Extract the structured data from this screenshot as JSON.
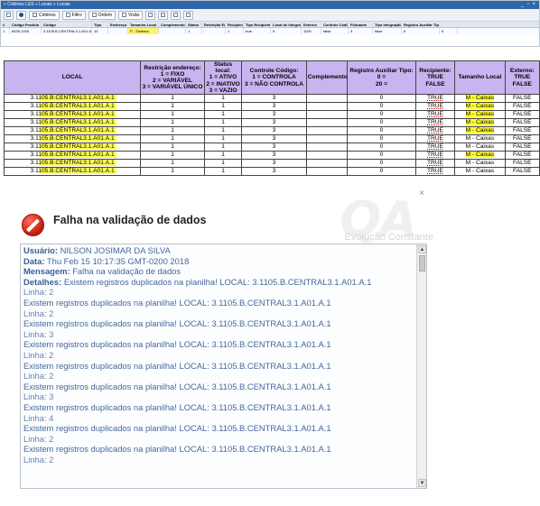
{
  "app": {
    "title": "» Critérios LES » Locais » Locais",
    "win_controls": "_ ▫ ×",
    "toolbar": [
      {
        "label": "",
        "icon": "refresh-icon"
      },
      {
        "label": "",
        "icon": "info-icon"
      },
      {
        "label": "Critérios",
        "icon": "filter-icon"
      },
      {
        "label": "Filtro",
        "icon": "funnel-icon"
      },
      {
        "label": "Ordem",
        "icon": "sort-icon"
      },
      {
        "label": "Visão",
        "icon": "view-icon"
      }
    ],
    "grid_headers": [
      "#",
      "Código Produto",
      "Código",
      "Tipo",
      "Endereço",
      "Tamanho Local",
      "Complemento",
      "Status",
      "Restrição End",
      "Recipiente",
      "Tipo Recipiente",
      "Local de Integração",
      "Externo",
      "Controle Código",
      "Flutuante",
      "Tipo Integração",
      "Registro Auxiliar Tipo"
    ],
    "grid_row": [
      "1",
      "8435-1155",
      "3.1105.B.CENTRAL3.1.A01.A.1",
      "10",
      "",
      "P - Sistema",
      "",
      "1",
      "",
      "1",
      "true",
      "5",
      "1105",
      "false",
      "3",
      "false",
      "5",
      "0"
    ]
  },
  "sheet": {
    "headers": [
      "LOCAL",
      "Restrição endereço:\n1 = FIXO\n2 = VARIÁVEL\n3 = VARIÁVEL ÚNICO",
      "Status local:\n1 = ATIVO\n2 = INATIVO\n3 = VAZIO",
      "Controle Código:\n1 = CONTROLA\n3 = NÃO CONTROLA",
      "Complemento",
      "Registro Auxiliar Tipo:\n0 =\n20 =",
      "Recipiente:\nTRUE\nFALSE",
      "Tamanho Local",
      "Externo:\nTRUE\nFALSE"
    ],
    "rows": [
      {
        "local": "3.1105.B.CENTRAL3.1.A01.A.1",
        "restr": "1",
        "status": "1",
        "ctrl": "3",
        "comp": "",
        "reg": "0",
        "recip": "TRUE",
        "tam": "M - Caixas",
        "ext": "FALSE"
      },
      {
        "local": "3.1105.B.CENTRAL3.1.A01.A.1",
        "restr": "1",
        "status": "1",
        "ctrl": "3",
        "comp": "",
        "reg": "0",
        "recip": "TRUE",
        "tam": "M - Caixas",
        "ext": "FALSE"
      },
      {
        "local": "3.1105.B.CENTRAL3.1.A01.A.1",
        "restr": "1",
        "status": "1",
        "ctrl": "3",
        "comp": "",
        "reg": "0",
        "recip": "TRUE",
        "tam": "M - Caixas",
        "ext": "FALSE"
      },
      {
        "local": "3.1105.B.CENTRAL3.1.A01.A.1",
        "restr": "1",
        "status": "1",
        "ctrl": "3",
        "comp": "",
        "reg": "0",
        "recip": "TRUE",
        "tam": "M - Caixas",
        "ext": "FALSE"
      },
      {
        "local": "3.1105.B.CENTRAL3.1.A01.A.1",
        "restr": "1",
        "status": "1",
        "ctrl": "3",
        "comp": "",
        "reg": "0",
        "recip": "TRUE",
        "tam": "M - Caixas",
        "ext": "FALSE"
      },
      {
        "local": "3.1105.B.CENTRAL3.1.A01.A.1",
        "restr": "1",
        "status": "1",
        "ctrl": "3",
        "comp": "",
        "reg": "0",
        "recip": "TRUE",
        "tam": "M - Caixas",
        "ext": "FALSE"
      },
      {
        "local": "3.1105.B.CENTRAL3.1.A01.A.1",
        "restr": "1",
        "status": "1",
        "ctrl": "3",
        "comp": "",
        "reg": "0",
        "recip": "TRUE",
        "tam": "M - Caixas",
        "ext": "FALSE"
      },
      {
        "local": "3.1105.B.CENTRAL3.1.A01.A.1",
        "restr": "1",
        "status": "1",
        "ctrl": "3",
        "comp": "",
        "reg": "0",
        "recip": "TRUE",
        "tam": "M - Caixas",
        "ext": "FALSE"
      },
      {
        "local": "3.1105.B.CENTRAL3.1.A01.A.1",
        "restr": "1",
        "status": "1",
        "ctrl": "3",
        "comp": "",
        "reg": "0",
        "recip": "TRUE",
        "tam": "M - Caixas",
        "ext": "FALSE"
      },
      {
        "local": "3.1105.B.CENTRAL3.1.A01.A.1",
        "restr": "1",
        "status": "1",
        "ctrl": "3",
        "comp": "",
        "reg": "0",
        "recip": "TRUE",
        "tam": "M - Caixas",
        "ext": "FALSE"
      }
    ],
    "highlight_color": "#ffff33",
    "header_color": "#c8b4f0"
  },
  "dialog": {
    "title": "Falha na validação de dados",
    "close": "×",
    "watermark_logo": "QA",
    "watermark_slogan": "Evolução Constante",
    "usuario_label": "Usuário:",
    "usuario": "NILSON JOSIMAR DA SILVA",
    "data_label": "Data:",
    "data": "Thu Feb 15 10:17:35 GMT-0200 2018",
    "mensagem_label": "Mensagem:",
    "mensagem": "Falha na validação de dados",
    "detalhes_label": "Detalhes:",
    "detalhes": "Existem registros duplicados na planilha! LOCAL: 3.1105.B.CENTRAL3.1.A01.A.1",
    "entries": [
      {
        "linha": "Linha: 2",
        "msg": "Existem registros duplicados na planilha! LOCAL: 3.1105.B.CENTRAL3.1.A01.A.1"
      },
      {
        "linha": "Linha: 2",
        "msg": "Existem registros duplicados na planilha! LOCAL: 3.1105.B.CENTRAL3.1.A01.A.1"
      },
      {
        "linha": "Linha: 3",
        "msg": "Existem registros duplicados na planilha! LOCAL: 3.1105.B.CENTRAL3.1.A01.A.1"
      },
      {
        "linha": "Linha: 2",
        "msg": "Existem registros duplicados na planilha! LOCAL: 3.1105.B.CENTRAL3.1.A01.A.1"
      },
      {
        "linha": "Linha: 2",
        "msg": "Existem registros duplicados na planilha! LOCAL: 3.1105.B.CENTRAL3.1.A01.A.1"
      },
      {
        "linha": "Linha: 3",
        "msg": "Existem registros duplicados na planilha! LOCAL: 3.1105.B.CENTRAL3.1.A01.A.1"
      },
      {
        "linha": "Linha: 4",
        "msg": "Existem registros duplicados na planilha! LOCAL: 3.1105.B.CENTRAL3.1.A01.A.1"
      },
      {
        "linha": "Linha: 2",
        "msg": "Existem registros duplicados na planilha! LOCAL: 3.1105.B.CENTRAL3.1.A01.A.1"
      },
      {
        "linha": "Linha: 2",
        "msg": ""
      }
    ]
  }
}
